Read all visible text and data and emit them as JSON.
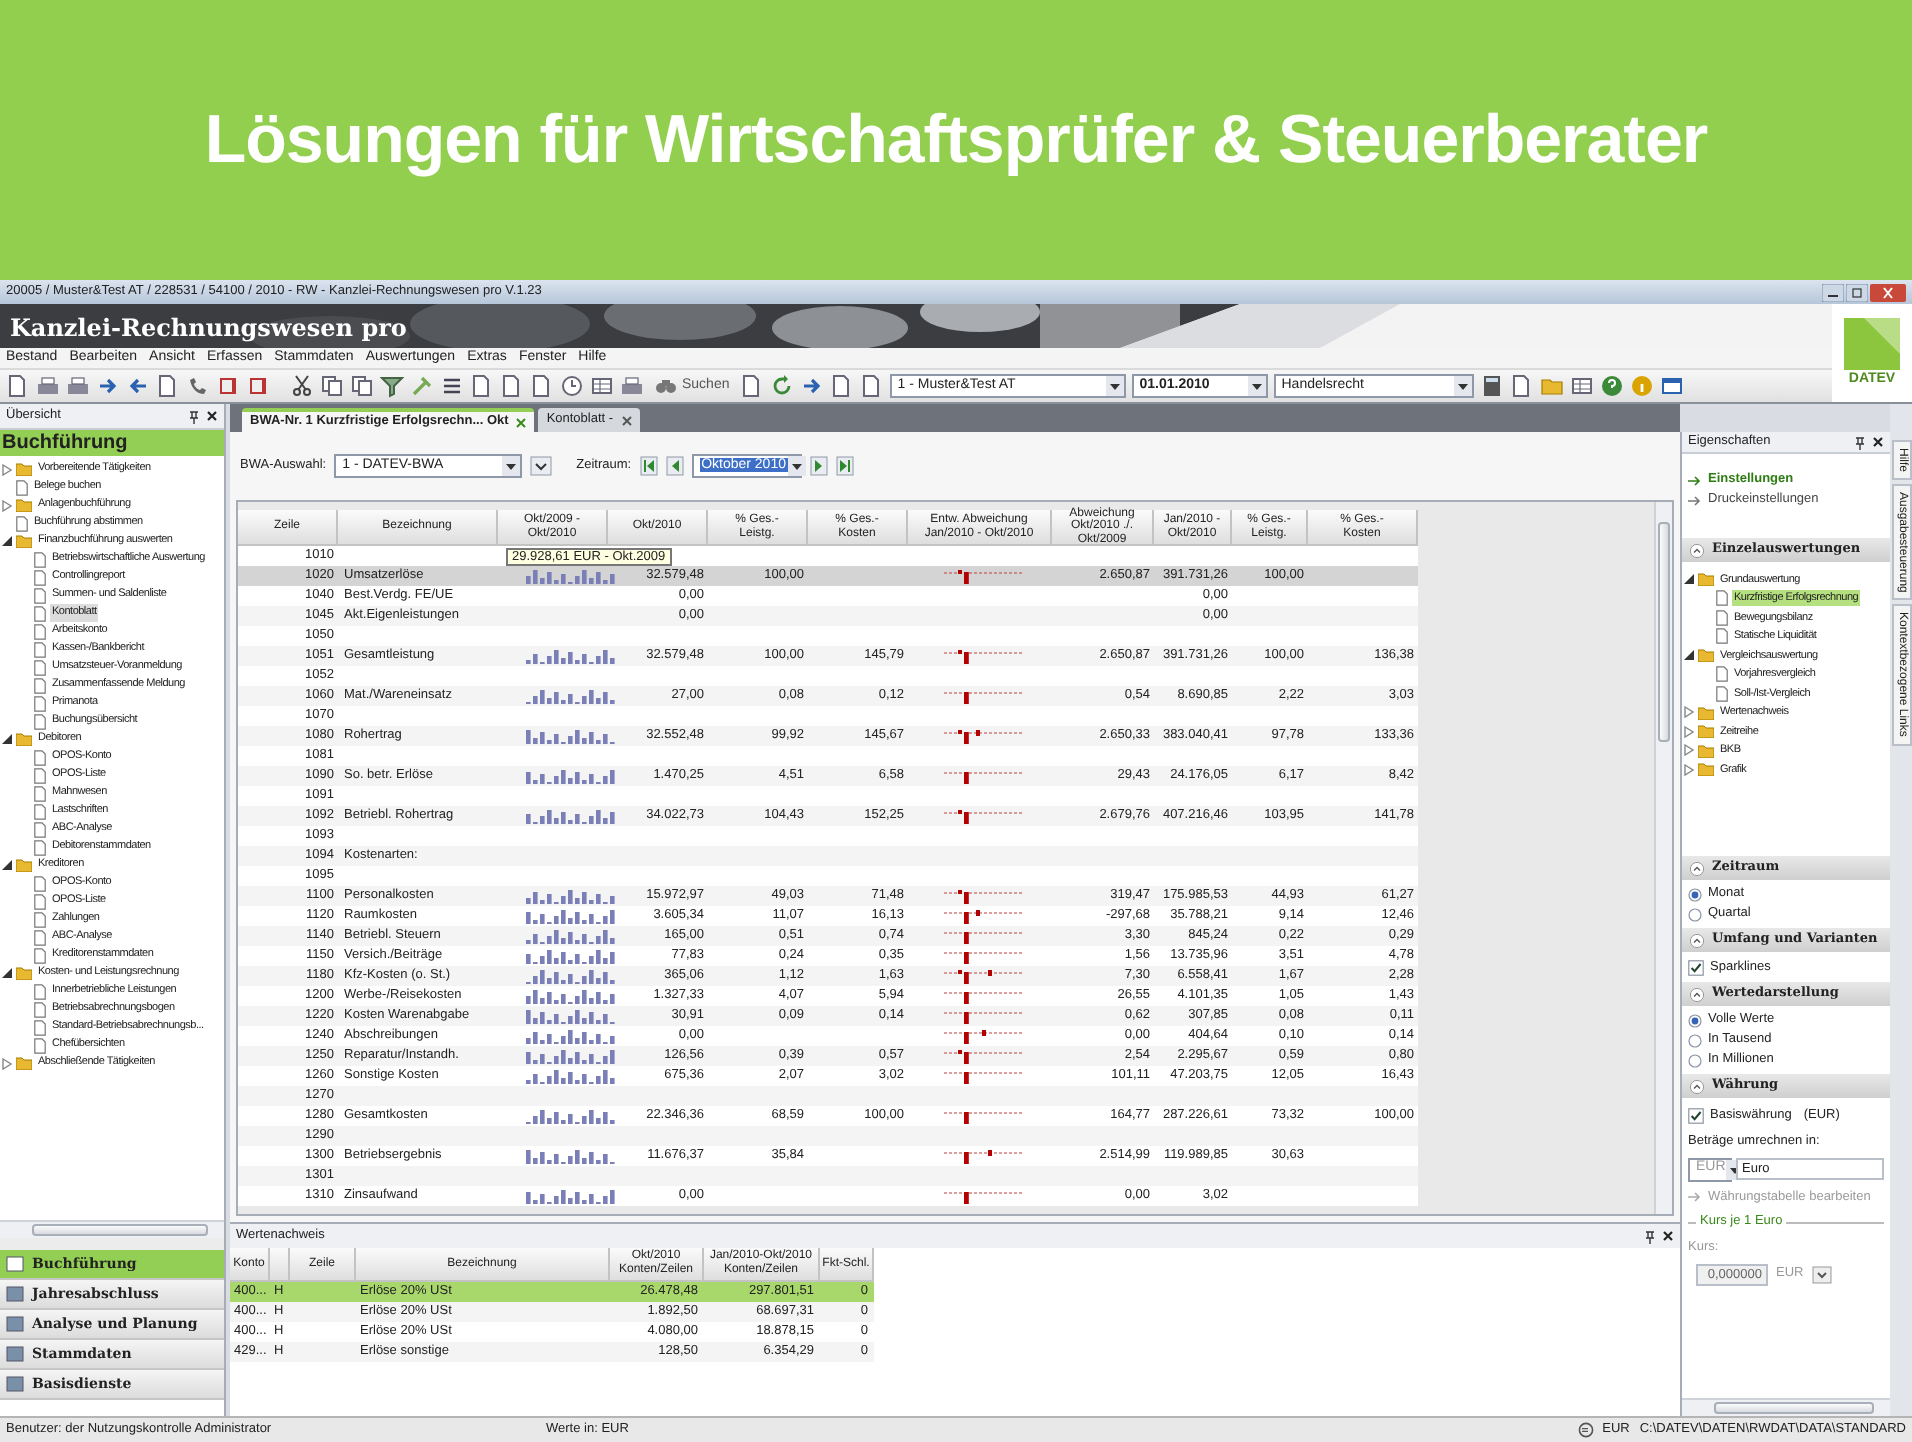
{
  "banner": {
    "title": "Lösungen für Wirtschaftsprüfer & Steuerberater"
  },
  "window": {
    "title": "20005 / Muster&Test AT / 228531 / 54100 / 2010 - RW - Kanzlei-Rechnungswesen pro V.1.23",
    "app_name": "Kanzlei-Rechnungswesen pro",
    "logo": "DATEV"
  },
  "menu": [
    "Bestand",
    "Bearbeiten",
    "Ansicht",
    "Erfassen",
    "Stammdaten",
    "Auswertungen",
    "Extras",
    "Fenster",
    "Hilfe"
  ],
  "toolbar": {
    "search_label": "Suchen",
    "client": "1 - Muster&Test AT",
    "date": "01.01.2010",
    "law": "Handelsrecht"
  },
  "overview": {
    "title": "Übersicht",
    "section": "Buchführung",
    "tree": [
      {
        "label": "Vorbereitende Tätigkeiten",
        "kind": "folder",
        "expanded": false,
        "selected": false
      },
      {
        "label": "Belege buchen",
        "kind": "document",
        "selected": false
      },
      {
        "label": "Anlagenbuchführung",
        "kind": "folder",
        "expanded": false,
        "selected": false
      },
      {
        "label": "Buchführung abstimmen",
        "kind": "document",
        "selected": false
      },
      {
        "label": "Finanzbuchführung auswerten",
        "kind": "folder",
        "expanded": true,
        "selected": false,
        "children": [
          {
            "label": "Betriebswirtschaftliche Auswertung",
            "kind": "document",
            "selected": false
          },
          {
            "label": "Controllingreport",
            "kind": "document",
            "selected": false
          },
          {
            "label": "Summen- und Saldenliste",
            "kind": "document",
            "selected": false
          },
          {
            "label": "Kontoblatt",
            "kind": "document",
            "selected": true
          },
          {
            "label": "Arbeitskonto",
            "kind": "document",
            "selected": false
          },
          {
            "label": "Kassen-/Bankbericht",
            "kind": "document",
            "selected": false
          },
          {
            "label": "Umsatzsteuer-Voranmeldung",
            "kind": "document",
            "selected": false
          },
          {
            "label": "Zusammenfassende Meldung",
            "kind": "document",
            "selected": false
          },
          {
            "label": "Primanota",
            "kind": "document",
            "selected": false
          },
          {
            "label": "Buchungsübersicht",
            "kind": "document",
            "selected": false
          }
        ]
      },
      {
        "label": "Debitoren",
        "kind": "folder",
        "expanded": true,
        "selected": false,
        "children": [
          {
            "label": "OPOS-Konto",
            "kind": "document",
            "selected": false
          },
          {
            "label": "OPOS-Liste",
            "kind": "document",
            "selected": false
          },
          {
            "label": "Mahnwesen",
            "kind": "document",
            "selected": false
          },
          {
            "label": "Lastschriften",
            "kind": "document",
            "selected": false
          },
          {
            "label": "ABC-Analyse",
            "kind": "document",
            "selected": false
          },
          {
            "label": "Debitorenstammdaten",
            "kind": "document",
            "selected": false
          }
        ]
      },
      {
        "label": "Kreditoren",
        "kind": "folder",
        "expanded": true,
        "selected": false,
        "children": [
          {
            "label": "OPOS-Konto",
            "kind": "document",
            "selected": false
          },
          {
            "label": "OPOS-Liste",
            "kind": "document",
            "selected": false
          },
          {
            "label": "Zahlungen",
            "kind": "document",
            "selected": false
          },
          {
            "label": "ABC-Analyse",
            "kind": "document",
            "selected": false
          },
          {
            "label": "Kreditorenstammdaten",
            "kind": "document",
            "selected": false
          }
        ]
      },
      {
        "label": "Kosten- und Leistungsrechnung",
        "kind": "folder",
        "expanded": true,
        "selected": false,
        "children": [
          {
            "label": "Innerbetriebliche Leistungen",
            "kind": "document",
            "selected": false
          },
          {
            "label": "Betriebsabrechnungsbogen",
            "kind": "document",
            "selected": false
          },
          {
            "label": "Standard-Betriebsabrechnungsb...",
            "kind": "document",
            "selected": false
          },
          {
            "label": "Chefübersichten",
            "kind": "document",
            "selected": false
          }
        ]
      },
      {
        "label": "Abschließende Tätigkeiten",
        "kind": "folder",
        "expanded": false,
        "selected": false
      }
    ]
  },
  "nav": [
    {
      "label": "Buchführung",
      "selected": true
    },
    {
      "label": "Jahresabschluss",
      "selected": false
    },
    {
      "label": "Analyse und Planung",
      "selected": false
    },
    {
      "label": "Stammdaten",
      "selected": false
    },
    {
      "label": "Basisdienste",
      "selected": false
    }
  ],
  "tabs": [
    {
      "label": "BWA-Nr. 1 Kurzfristige Erfolgsrechn... Okt",
      "selected": true
    },
    {
      "label": "Kontoblatt -",
      "selected": false
    }
  ],
  "filters": {
    "bwa_label": "BWA-Auswahl:",
    "bwa_value": "1 - DATEV-BWA",
    "period_label": "Zeitraum:",
    "period_value": "Oktober 2010"
  },
  "table": {
    "columns": [
      "Zeile",
      "Bezeichnung",
      "Okt/2009 - Okt/2010",
      "Okt/2010",
      "% Ges.-\nLeistg.",
      "% Ges.-\nKosten",
      "Entw. Abweichung\nJan/2010 - Okt/2010",
      "Abweichung\nOkt/2010 ./. Okt/2009",
      "Jan/2010 -\nOkt/2010",
      "% Ges.-\nLeistg.",
      "% Ges.-\nKosten"
    ],
    "tooltip": "29.928,61 EUR - Okt.2009",
    "rows": [
      {
        "line": "1010",
        "sparklines": false,
        "selected": false
      },
      {
        "line": "1020",
        "label": "Umsatzerlöse",
        "okt_2010": "32.579,48",
        "pct_leistg": "100,00",
        "abweichung": "2.650,87",
        "jan_okt": "391.731,26",
        "pct_leistg_cum": "100,00",
        "sparklines": true,
        "selected": true
      },
      {
        "line": "1040",
        "label": "Best.Verdg. FE/UE",
        "okt_2010": "0,00",
        "jan_okt": "0,00",
        "sparklines": false,
        "selected": false
      },
      {
        "line": "1045",
        "label": "Akt.Eigenleistungen",
        "okt_2010": "0,00",
        "jan_okt": "0,00",
        "sparklines": false,
        "selected": false
      },
      {
        "line": "1050",
        "sparklines": false,
        "selected": false
      },
      {
        "line": "1051",
        "label": "Gesamtleistung",
        "okt_2010": "32.579,48",
        "pct_leistg": "100,00",
        "pct_kosten": "145,79",
        "abweichung": "2.650,87",
        "jan_okt": "391.731,26",
        "pct_leistg_cum": "100,00",
        "pct_kosten_cum": "136,38",
        "sparklines": true,
        "selected": false
      },
      {
        "line": "1052",
        "sparklines": false,
        "selected": false
      },
      {
        "line": "1060",
        "label": "Mat./Wareneinsatz",
        "okt_2010": "27,00",
        "pct_leistg": "0,08",
        "pct_kosten": "0,12",
        "abweichung": "0,54",
        "jan_okt": "8.690,85",
        "pct_leistg_cum": "2,22",
        "pct_kosten_cum": "3,03",
        "sparklines": true,
        "selected": false
      },
      {
        "line": "1070",
        "sparklines": false,
        "selected": false
      },
      {
        "line": "1080",
        "label": "Rohertrag",
        "okt_2010": "32.552,48",
        "pct_leistg": "99,92",
        "pct_kosten": "145,67",
        "abweichung": "2.650,33",
        "jan_okt": "383.040,41",
        "pct_leistg_cum": "97,78",
        "pct_kosten_cum": "133,36",
        "sparklines": true,
        "selected": false
      },
      {
        "line": "1081",
        "sparklines": false,
        "selected": false
      },
      {
        "line": "1090",
        "label": "So. betr. Erlöse",
        "okt_2010": "1.470,25",
        "pct_leistg": "4,51",
        "pct_kosten": "6,58",
        "abweichung": "29,43",
        "jan_okt": "24.176,05",
        "pct_leistg_cum": "6,17",
        "pct_kosten_cum": "8,42",
        "sparklines": true,
        "selected": false
      },
      {
        "line": "1091",
        "sparklines": false,
        "selected": false
      },
      {
        "line": "1092",
        "label": "Betriebl. Rohertrag",
        "okt_2010": "34.022,73",
        "pct_leistg": "104,43",
        "pct_kosten": "152,25",
        "abweichung": "2.679,76",
        "jan_okt": "407.216,46",
        "pct_leistg_cum": "103,95",
        "pct_kosten_cum": "141,78",
        "sparklines": true,
        "selected": false
      },
      {
        "line": "1093",
        "sparklines": false,
        "selected": false
      },
      {
        "line": "1094",
        "label": "Kostenarten:",
        "sparklines": false,
        "selected": false
      },
      {
        "line": "1095",
        "sparklines": false,
        "selected": false
      },
      {
        "line": "1100",
        "label": "Personalkosten",
        "okt_2010": "15.972,97",
        "pct_leistg": "49,03",
        "pct_kosten": "71,48",
        "abweichung": "319,47",
        "jan_okt": "175.985,53",
        "pct_leistg_cum": "44,93",
        "pct_kosten_cum": "61,27",
        "sparklines": true,
        "selected": false
      },
      {
        "line": "1120",
        "label": "Raumkosten",
        "okt_2010": "3.605,34",
        "pct_leistg": "11,07",
        "pct_kosten": "16,13",
        "abweichung": "-297,68",
        "jan_okt": "35.788,21",
        "pct_leistg_cum": "9,14",
        "pct_kosten_cum": "12,46",
        "sparklines": true,
        "selected": false
      },
      {
        "line": "1140",
        "label": "Betriebl. Steuern",
        "okt_2010": "165,00",
        "pct_leistg": "0,51",
        "pct_kosten": "0,74",
        "abweichung": "3,30",
        "jan_okt": "845,24",
        "pct_leistg_cum": "0,22",
        "pct_kosten_cum": "0,29",
        "sparklines": true,
        "selected": false
      },
      {
        "line": "1150",
        "label": "Versich./Beiträge",
        "okt_2010": "77,83",
        "pct_leistg": "0,24",
        "pct_kosten": "0,35",
        "abweichung": "1,56",
        "jan_okt": "13.735,96",
        "pct_leistg_cum": "3,51",
        "pct_kosten_cum": "4,78",
        "sparklines": true,
        "selected": false
      },
      {
        "line": "1180",
        "label": "Kfz-Kosten (o. St.)",
        "okt_2010": "365,06",
        "pct_leistg": "1,12",
        "pct_kosten": "1,63",
        "abweichung": "7,30",
        "jan_okt": "6.558,41",
        "pct_leistg_cum": "1,67",
        "pct_kosten_cum": "2,28",
        "sparklines": true,
        "selected": false
      },
      {
        "line": "1200",
        "label": "Werbe-/Reisekosten",
        "okt_2010": "1.327,33",
        "pct_leistg": "4,07",
        "pct_kosten": "5,94",
        "abweichung": "26,55",
        "jan_okt": "4.101,35",
        "pct_leistg_cum": "1,05",
        "pct_kosten_cum": "1,43",
        "sparklines": true,
        "selected": false
      },
      {
        "line": "1220",
        "label": "Kosten Warenabgabe",
        "okt_2010": "30,91",
        "pct_leistg": "0,09",
        "pct_kosten": "0,14",
        "abweichung": "0,62",
        "jan_okt": "307,85",
        "pct_leistg_cum": "0,08",
        "pct_kosten_cum": "0,11",
        "sparklines": true,
        "selected": false
      },
      {
        "line": "1240",
        "label": "Abschreibungen",
        "okt_2010": "0,00",
        "abweichung": "0,00",
        "jan_okt": "404,64",
        "pct_leistg_cum": "0,10",
        "pct_kosten_cum": "0,14",
        "sparklines": true,
        "selected": false
      },
      {
        "line": "1250",
        "label": "Reparatur/Instandh.",
        "okt_2010": "126,56",
        "pct_leistg": "0,39",
        "pct_kosten": "0,57",
        "abweichung": "2,54",
        "jan_okt": "2.295,67",
        "pct_leistg_cum": "0,59",
        "pct_kosten_cum": "0,80",
        "sparklines": true,
        "selected": false
      },
      {
        "line": "1260",
        "label": "Sonstige Kosten",
        "okt_2010": "675,36",
        "pct_leistg": "2,07",
        "pct_kosten": "3,02",
        "abweichung": "101,11",
        "jan_okt": "47.203,75",
        "pct_leistg_cum": "12,05",
        "pct_kosten_cum": "16,43",
        "sparklines": true,
        "selected": false
      },
      {
        "line": "1270",
        "sparklines": false,
        "selected": false
      },
      {
        "line": "1280",
        "label": "Gesamtkosten",
        "okt_2010": "22.346,36",
        "pct_leistg": "68,59",
        "pct_kosten": "100,00",
        "abweichung": "164,77",
        "jan_okt": "287.226,61",
        "pct_leistg_cum": "73,32",
        "pct_kosten_cum": "100,00",
        "sparklines": true,
        "selected": false
      },
      {
        "line": "1290",
        "sparklines": false,
        "selected": false
      },
      {
        "line": "1300",
        "label": "Betriebsergebnis",
        "okt_2010": "11.676,37",
        "pct_leistg": "35,84",
        "abweichung": "2.514,99",
        "jan_okt": "119.989,85",
        "pct_leistg_cum": "30,63",
        "sparklines": true,
        "selected": false
      },
      {
        "line": "1301",
        "sparklines": false,
        "selected": false
      },
      {
        "line": "1310",
        "label": "Zinsaufwand",
        "okt_2010": "0,00",
        "abweichung": "0,00",
        "jan_okt": "3,02",
        "sparklines": true,
        "selected": false
      }
    ]
  },
  "values_panel": {
    "title": "Wertenachweis",
    "columns": [
      "Konto",
      null,
      "Zeile",
      "Bezeichnung",
      "Okt/2010\nKonten/Zeilen",
      "Jan/2010-Okt/2010\nKonten/Zeilen",
      "Fkt-Schl."
    ],
    "rows": [
      {
        "account": "400...",
        "side": "H",
        "label": "Erlöse 20% USt",
        "okt_2010": "26.478,48",
        "jan_okt": "297.801,51",
        "key": "0",
        "selected": true
      },
      {
        "account": "400...",
        "side": "H",
        "label": "Erlöse 20% USt",
        "okt_2010": "1.892,50",
        "jan_okt": "68.697,31",
        "key": "0",
        "selected": false
      },
      {
        "account": "400...",
        "side": "H",
        "label": "Erlöse 20% USt",
        "okt_2010": "4.080,00",
        "jan_okt": "18.878,15",
        "key": "0",
        "selected": false
      },
      {
        "account": "429...",
        "side": "H",
        "label": "Erlöse sonstige",
        "okt_2010": "128,50",
        "jan_okt": "6.354,29",
        "key": "0",
        "selected": false
      }
    ]
  },
  "properties": {
    "title": "Eigenschaften",
    "links": [
      {
        "label": "Einstellungen",
        "selected": true
      },
      {
        "label": "Druckeinstellungen",
        "selected": false
      }
    ],
    "sections": [
      {
        "kind": "tree",
        "title": "Einzelauswertungen",
        "expanded": true,
        "items": [
          {
            "label": "Grundauswertung",
            "kind": "folder",
            "expanded": true,
            "selected": false,
            "children": [
              {
                "label": "Kurzfristige Erfolgsrechnung",
                "kind": "document",
                "selected": true
              },
              {
                "label": "Bewegungsbilanz",
                "kind": "document",
                "selected": false
              },
              {
                "label": "Statische Liquidität",
                "kind": "document",
                "selected": false
              }
            ]
          },
          {
            "label": "Vergleichsauswertung",
            "kind": "folder",
            "expanded": true,
            "selected": false,
            "children": [
              {
                "label": "Vorjahresvergleich",
                "kind": "document",
                "selected": false
              },
              {
                "label": "Soll-/Ist-Vergleich",
                "kind": "document",
                "selected": false
              }
            ]
          },
          {
            "label": "Wertenachweis",
            "kind": "folder",
            "expanded": false,
            "selected": false
          },
          {
            "label": "Zeitreihe",
            "kind": "folder",
            "expanded": false,
            "selected": false
          },
          {
            "label": "BKB",
            "kind": "folder",
            "expanded": false,
            "selected": false
          },
          {
            "label": "Grafik",
            "kind": "folder",
            "expanded": false,
            "selected": false
          }
        ]
      },
      {
        "kind": "radio",
        "title": "Zeitraum",
        "expanded": true,
        "options": [
          {
            "label": "Monat",
            "selected": true
          },
          {
            "label": "Quartal",
            "selected": false
          }
        ]
      },
      {
        "kind": "checkbox",
        "title": "Umfang und Varianten",
        "expanded": true,
        "options": [
          {
            "label": "Sparklines",
            "checked": true
          }
        ]
      },
      {
        "kind": "radio",
        "title": "Wertedarstellung",
        "expanded": true,
        "options": [
          {
            "label": "Volle Werte",
            "selected": true
          },
          {
            "label": "In Tausend",
            "selected": false
          },
          {
            "label": "In Millionen",
            "selected": false
          }
        ]
      },
      {
        "kind": "currency",
        "title": "Währung",
        "expanded": true,
        "base_label": "Basiswährung",
        "base_checked": true,
        "base_value": "(EUR)",
        "convert_label": "Beträge umrechnen in:",
        "currency_code": "EUR",
        "currency_name": "Euro",
        "edit_link": "Währungstabelle bearbeiten",
        "rate_group": "Kurs je 1 Euro",
        "rate_label": "Kurs:",
        "rate_value": "0,000000",
        "rate_unit": "EUR"
      }
    ]
  },
  "side_tabs": [
    "Hilfe",
    "Ausgabesteuerung",
    "Kontextbezogene Links"
  ],
  "status_bar": {
    "user": "Benutzer: der Nutzungskontrolle Administrator",
    "units": "Werte in: EUR",
    "currency": "EUR",
    "path": "C:\\DATEV\\DATEN\\RWDAT\\DATA\\STANDARD"
  }
}
